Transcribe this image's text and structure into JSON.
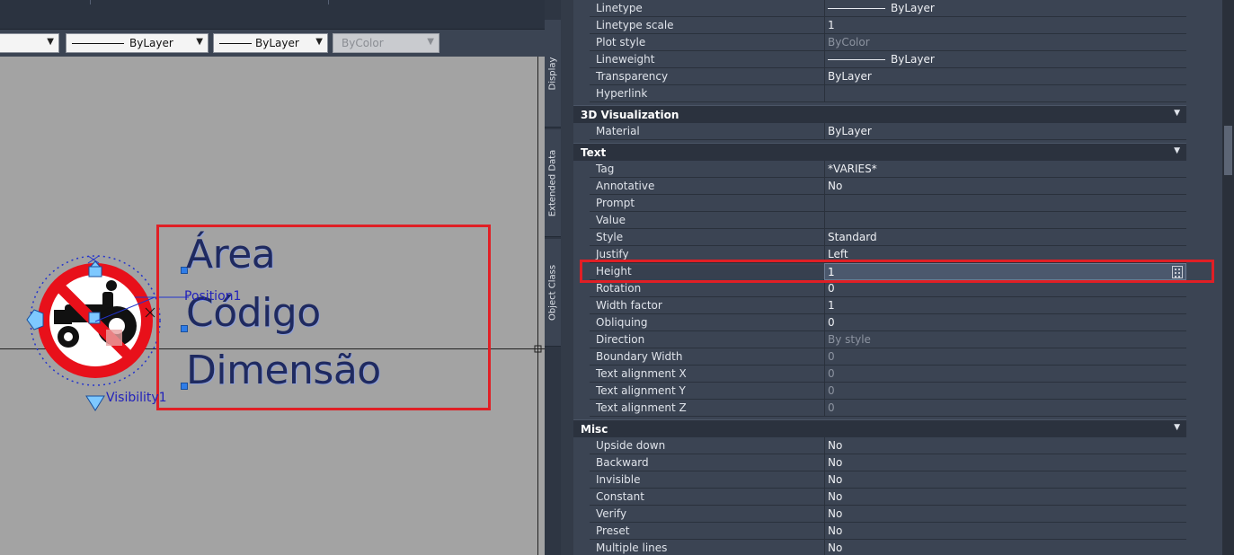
{
  "toolbar": {
    "color_dropdown": "",
    "linetype_dropdown": "ByLayer",
    "lineweight_dropdown": "ByLayer",
    "plotstyle_dropdown": "ByColor"
  },
  "canvas": {
    "attributes": [
      "Área",
      "Código",
      "Dimensão"
    ],
    "position_param": "Position1",
    "visibility_param": "Visibility1"
  },
  "side_tabs": [
    "Display",
    "Extended Data",
    "Object Class"
  ],
  "properties": {
    "general_rows": [
      {
        "name": "Linetype",
        "value": "ByLayer",
        "line": true
      },
      {
        "name": "Linetype scale",
        "value": "1"
      },
      {
        "name": "Plot style",
        "value": "ByColor",
        "dim": true
      },
      {
        "name": "Lineweight",
        "value": "ByLayer",
        "line": true
      },
      {
        "name": "Transparency",
        "value": "ByLayer"
      },
      {
        "name": "Hyperlink",
        "value": ""
      }
    ],
    "viz_title": "3D Visualization",
    "viz_rows": [
      {
        "name": "Material",
        "value": "ByLayer"
      }
    ],
    "text_title": "Text",
    "text_rows": [
      {
        "name": "Tag",
        "value": "*VARIES*"
      },
      {
        "name": "Annotative",
        "value": "No"
      },
      {
        "name": "Prompt",
        "value": ""
      },
      {
        "name": "Value",
        "value": ""
      },
      {
        "name": "Style",
        "value": "Standard"
      },
      {
        "name": "Justify",
        "value": "Left"
      },
      {
        "name": "Height",
        "value": "1",
        "selected": true
      },
      {
        "name": "Rotation",
        "value": "0"
      },
      {
        "name": "Width factor",
        "value": "1"
      },
      {
        "name": "Obliquing",
        "value": "0"
      },
      {
        "name": "Direction",
        "value": "By style",
        "dim": true
      },
      {
        "name": "Boundary Width",
        "value": "0",
        "dim": true
      },
      {
        "name": "Text alignment X",
        "value": "0",
        "dim": true
      },
      {
        "name": "Text alignment Y",
        "value": "0",
        "dim": true
      },
      {
        "name": "Text alignment Z",
        "value": "0",
        "dim": true
      }
    ],
    "misc_title": "Misc",
    "misc_rows": [
      {
        "name": "Upside down",
        "value": "No"
      },
      {
        "name": "Backward",
        "value": "No"
      },
      {
        "name": "Invisible",
        "value": "No"
      },
      {
        "name": "Constant",
        "value": "No"
      },
      {
        "name": "Verify",
        "value": "No"
      },
      {
        "name": "Preset",
        "value": "No"
      },
      {
        "name": "Multiple lines",
        "value": "No"
      }
    ]
  },
  "colors": {
    "highlight": "#e01f25",
    "canvas": "#a3a3a3",
    "panel": "#3b4453",
    "grip": "#2f7de8"
  }
}
